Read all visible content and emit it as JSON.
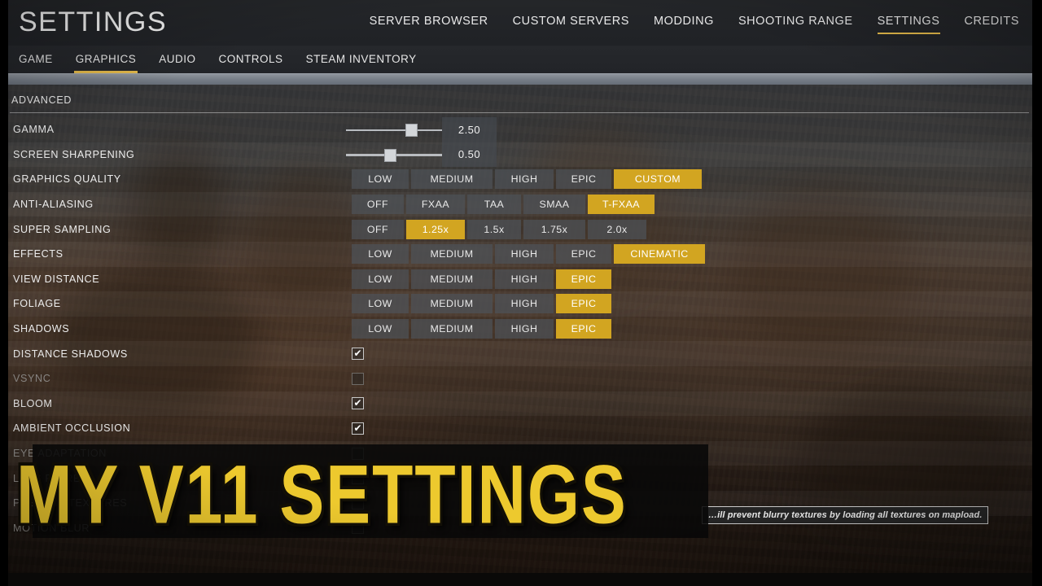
{
  "header": {
    "title": "SETTINGS",
    "nav": [
      {
        "label": "SERVER BROWSER",
        "active": false
      },
      {
        "label": "CUSTOM SERVERS",
        "active": false
      },
      {
        "label": "MODDING",
        "active": false
      },
      {
        "label": "SHOOTING RANGE",
        "active": false
      },
      {
        "label": "SETTINGS",
        "active": true
      },
      {
        "label": "CREDITS",
        "active": false
      }
    ]
  },
  "subtabs": [
    {
      "label": "GAME",
      "active": false
    },
    {
      "label": "GRAPHICS",
      "active": true
    },
    {
      "label": "AUDIO",
      "active": false
    },
    {
      "label": "CONTROLS",
      "active": false
    },
    {
      "label": "STEAM INVENTORY",
      "active": false
    }
  ],
  "section": {
    "title": "ADVANCED"
  },
  "settings": {
    "gamma": {
      "label": "GAMMA",
      "value": "2.50",
      "slider_percent": 71
    },
    "screen_sharpening": {
      "label": "SCREEN SHARPENING",
      "value": "0.50",
      "slider_percent": 46
    },
    "graphics_quality": {
      "label": "GRAPHICS QUALITY",
      "options": [
        "LOW",
        "MEDIUM",
        "HIGH",
        "EPIC",
        "CUSTOM"
      ],
      "selected": "CUSTOM"
    },
    "anti_aliasing": {
      "label": "ANTI-ALIASING",
      "options": [
        "OFF",
        "FXAA",
        "TAA",
        "SMAA",
        "T-FXAA"
      ],
      "selected": "T-FXAA"
    },
    "super_sampling": {
      "label": "SUPER SAMPLING",
      "options": [
        "OFF",
        "1.25x",
        "1.5x",
        "1.75x",
        "2.0x"
      ],
      "selected": "1.25x"
    },
    "effects": {
      "label": "EFFECTS",
      "options": [
        "LOW",
        "MEDIUM",
        "HIGH",
        "EPIC",
        "CINEMATIC"
      ],
      "selected": "CINEMATIC"
    },
    "view_distance": {
      "label": "VIEW DISTANCE",
      "options": [
        "LOW",
        "MEDIUM",
        "HIGH",
        "EPIC"
      ],
      "selected": "EPIC"
    },
    "foliage": {
      "label": "FOLIAGE",
      "options": [
        "LOW",
        "MEDIUM",
        "HIGH",
        "EPIC"
      ],
      "selected": "EPIC"
    },
    "shadows": {
      "label": "SHADOWS",
      "options": [
        "LOW",
        "MEDIUM",
        "HIGH",
        "EPIC"
      ],
      "selected": "EPIC"
    },
    "distance_shadows": {
      "label": "DISTANCE SHADOWS",
      "checked": true,
      "dim": false
    },
    "vsync": {
      "label": "VSYNC",
      "checked": false,
      "dim": true
    },
    "bloom": {
      "label": "BLOOM",
      "checked": true,
      "dim": false
    },
    "ambient_occlusion": {
      "label": "AMBIENT OCCLUSION",
      "checked": true,
      "dim": false
    },
    "eye_adaptation": {
      "label": "EYE ADAPTATION",
      "checked": false,
      "dim": true
    },
    "lens_flare": {
      "label": "LENS FLARE",
      "checked": false,
      "dim": true
    },
    "preload_textures": {
      "label": "PRELOAD TEXTURES",
      "checked": false,
      "dim": true
    },
    "motion_blur": {
      "label": "MOTION BLUR",
      "checked": false,
      "dim": true
    }
  },
  "tooltip": {
    "text": "…ill prevent blurry textures by loading all textures on mapload."
  },
  "checkbox_glyph": "✔",
  "overlay": {
    "text": "MY V11 SETTINGS"
  },
  "colors": {
    "accent": "#d2a521",
    "tab_underline": "#e2b84a",
    "overlay_yellow": "#edc92e",
    "panel_text": "#ededed",
    "dim_text": "#8e8b88",
    "option_bg": "#4e5258"
  }
}
